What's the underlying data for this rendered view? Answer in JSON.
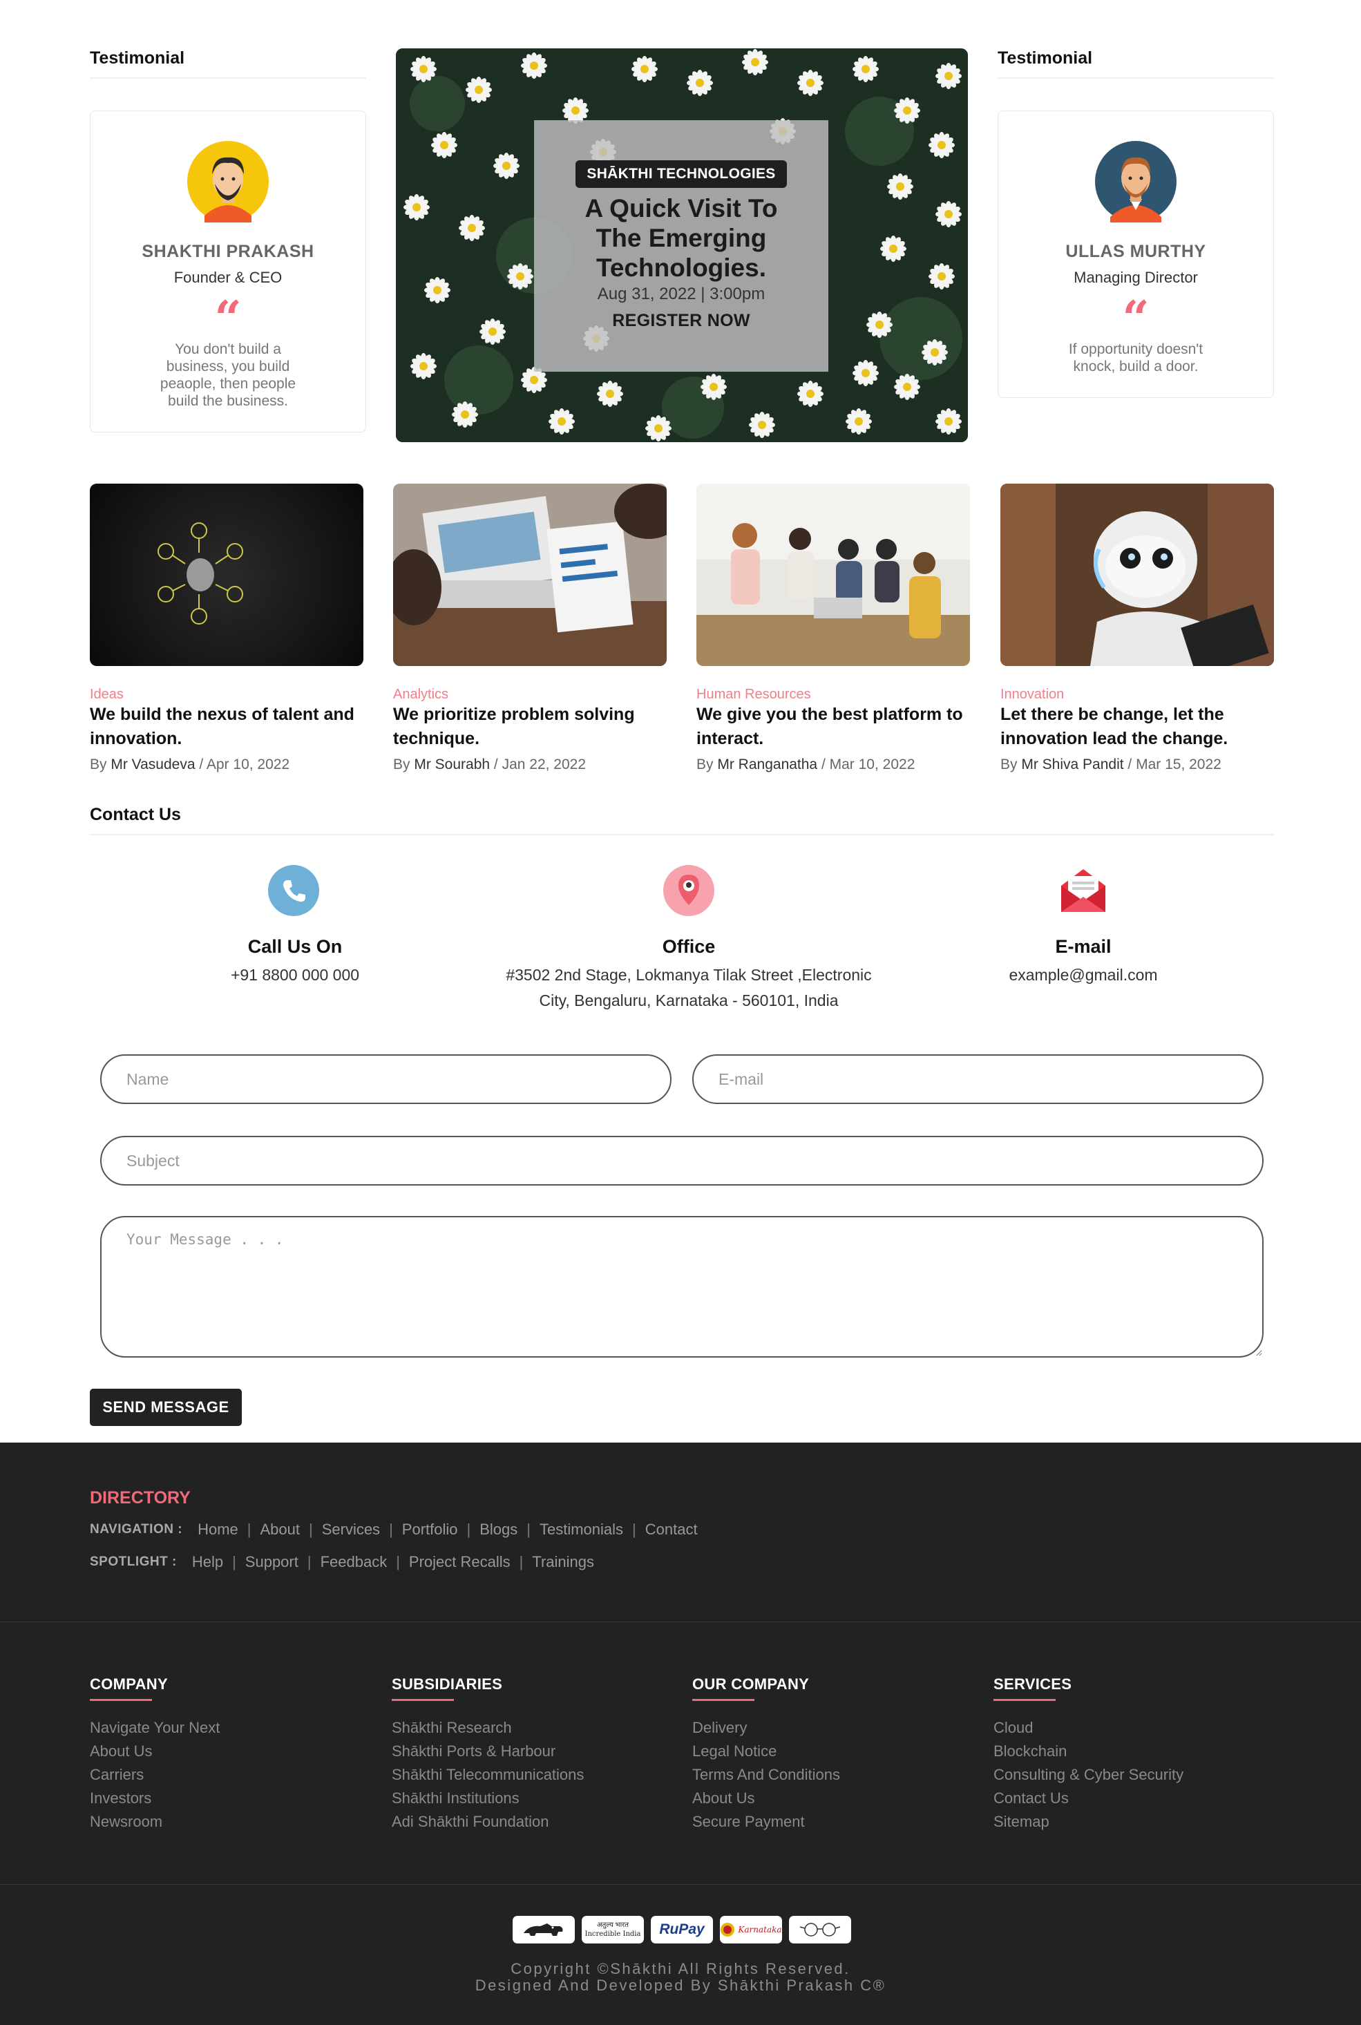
{
  "testimonials": {
    "left": {
      "section_title": "Testimonial",
      "name": "SHAKTHI PRAKASH",
      "role": "Founder & CEO",
      "quote_mark": "“",
      "quote": "You don't build a business, you build peaople, then people build the business."
    },
    "right": {
      "section_title": "Testimonial",
      "name": "ULLAS MURTHY",
      "role": "Managing Director",
      "quote_mark": "“",
      "quote": "If opportunity doesn't knock, build a door."
    }
  },
  "banner": {
    "brand": "SHĀKTHI TECHNOLOGIES",
    "title": "A Quick Visit To The Emerging Technologies.",
    "datetime": "Aug 31, 2022 | 3:00pm",
    "cta": "REGISTER NOW"
  },
  "posts": [
    {
      "category": "Ideas",
      "title": "We build the nexus of talent and innovation.",
      "by": "By",
      "author": "Mr Vasudeva",
      "date": " / Apr 10, 2022"
    },
    {
      "category": "Analytics",
      "title": "We prioritize problem solving technique.",
      "by": "By",
      "author": "Mr Sourabh",
      "date": " / Jan 22, 2022"
    },
    {
      "category": "Human Resources",
      "title": "We give you the best platform to interact.",
      "by": "By",
      "author": "Mr Ranganatha",
      "date": " / Mar 10, 2022"
    },
    {
      "category": "Innovation",
      "title": "Let there be change, let the innovation lead the change.",
      "by": "By",
      "author": "Mr Shiva Pandit",
      "date": " / Mar 15, 2022"
    }
  ],
  "contact": {
    "section_title": "Contact Us",
    "phone": {
      "heading": "Call Us On",
      "value": "+91 8800 000 000"
    },
    "office": {
      "heading": "Office",
      "line1": "#3502 2nd Stage, Lokmanya Tilak Street ,Electronic",
      "line2": "City, Bengaluru, Karnataka - 560101, India"
    },
    "email": {
      "heading": "E-mail",
      "value": "example@gmail.com"
    },
    "form": {
      "name_placeholder": "Name",
      "email_placeholder": "E-mail",
      "subject_placeholder": "Subject",
      "message_placeholder": "Your Message . . .",
      "send_label": "SEND MESSAGE"
    }
  },
  "directory": {
    "title": "DIRECTORY",
    "navigation_label": "NAVIGATION :",
    "navigation": [
      "Home",
      "About",
      "Services",
      "Portfolio",
      "Blogs",
      "Testimonials",
      "Contact"
    ],
    "spotlight_label": "SPOTLIGHT :",
    "spotlight": [
      "Help",
      "Support",
      "Feedback",
      "Project Recalls",
      "Trainings"
    ]
  },
  "footer_columns": [
    {
      "title": "COMPANY",
      "links": [
        "Navigate Your Next",
        "About Us",
        "Carriers",
        "Investors",
        "Newsroom"
      ]
    },
    {
      "title": "SUBSIDIARIES",
      "links": [
        "Shākthi Research",
        "Shākthi Ports & Harbour",
        "Shākthi Telecommunications",
        "Shākthi Institutions",
        "Adi Shākthi Foundation"
      ]
    },
    {
      "title": "OUR COMPANY",
      "links": [
        "Delivery",
        "Legal Notice",
        "Terms And Conditions",
        "About Us",
        "Secure Payment"
      ]
    },
    {
      "title": "SERVICES",
      "links": [
        "Cloud",
        "Blockchain",
        "Consulting & Cyber Security",
        "Contact Us",
        "Sitemap"
      ]
    }
  ],
  "badges": {
    "b2_top": "अतुल्य भारत",
    "b2_bottom": "Incredible India",
    "rupay": "RuPay",
    "karnataka": "Karnataka"
  },
  "copyright": {
    "line1": "Copyright ©Shākthi All Rights Reserved.",
    "line2": "Designed And Developed By Shākthi Prakash C®"
  },
  "colors": {
    "accent": "#f06a7a",
    "dark": "#222222",
    "category": "#f07e8b"
  }
}
